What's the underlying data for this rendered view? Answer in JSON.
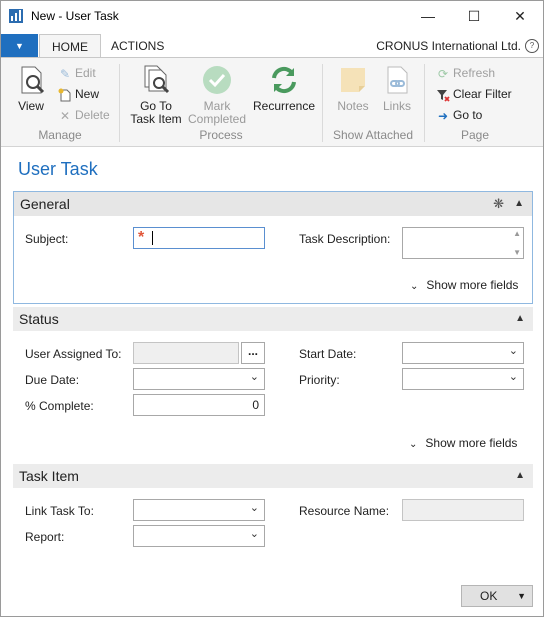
{
  "window": {
    "title": "New - User Task"
  },
  "ribbon_tabs": {
    "home": "HOME",
    "actions": "ACTIONS"
  },
  "company": "CRONUS International Ltd.",
  "ribbon": {
    "view": "View",
    "edit": "Edit",
    "new": "New",
    "delete": "Delete",
    "manage_group": "Manage",
    "goto_task_item": [
      "Go To",
      "Task Item"
    ],
    "mark_completed": [
      "Mark",
      "Completed"
    ],
    "recurrence": "Recurrence",
    "process_group": "Process",
    "notes": "Notes",
    "links": "Links",
    "show_attached_group": "Show Attached",
    "refresh": "Refresh",
    "clear_filter": "Clear Filter",
    "go_to": "Go to",
    "page_group": "Page"
  },
  "page_title": "User Task",
  "general": {
    "header": "General",
    "subject_label": "Subject:",
    "subject_value": "",
    "task_description_label": "Task Description:",
    "show_more": "Show more fields"
  },
  "status": {
    "header": "Status",
    "user_assigned_label": "User Assigned To:",
    "lookup_label": "...",
    "due_date_label": "Due Date:",
    "percent_complete_label": "% Complete:",
    "percent_complete_value": "0",
    "start_date_label": "Start Date:",
    "priority_label": "Priority:",
    "show_more": "Show more fields"
  },
  "task_item": {
    "header": "Task Item",
    "link_task_to_label": "Link Task To:",
    "report_label": "Report:",
    "resource_name_label": "Resource Name:"
  },
  "ok_button": "OK",
  "colors": {
    "accent": "#1f6fbf",
    "required": "#e1573a",
    "ribbon_bg": "#f5f5f5"
  }
}
